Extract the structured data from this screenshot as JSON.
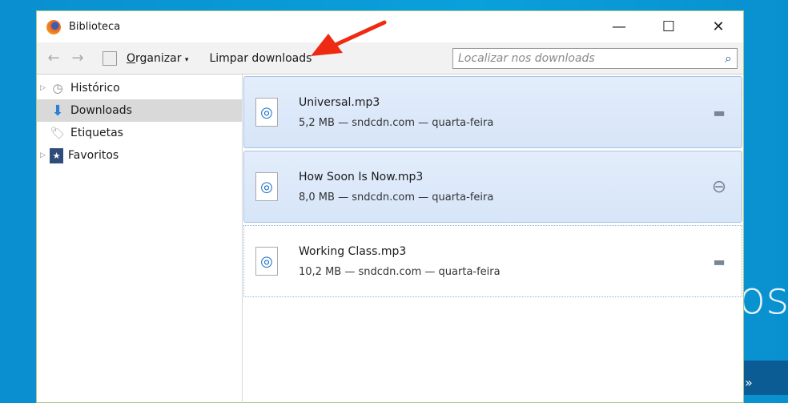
{
  "window": {
    "title": "Biblioteca",
    "minimize": "—",
    "maximize": "☐",
    "close": "✕"
  },
  "toolbar": {
    "back": "←",
    "forward": "→",
    "organize_key": "O",
    "organize_rest": "rganizar",
    "organize_caret": "▾",
    "clear": "Limpar downloads",
    "search_placeholder": "Localizar nos downloads"
  },
  "sidebar": {
    "items": [
      {
        "label": "Histórico",
        "icon": "clock-icon",
        "twisty": true
      },
      {
        "label": "Downloads",
        "icon": "download-arrow-icon",
        "selected": true
      },
      {
        "label": "Etiquetas",
        "icon": "tag-icon"
      },
      {
        "label": "Favoritos",
        "icon": "bookmarks-icon",
        "twisty": true
      }
    ]
  },
  "downloads": [
    {
      "name": "Universal.mp3",
      "meta": "5,2 MB — sndcdn.com — quarta-feira",
      "action": "folder-icon"
    },
    {
      "name": "How Soon Is Now.mp3",
      "meta": "8,0 MB — sndcdn.com — quarta-feira",
      "action": "open-folder-circle-icon"
    },
    {
      "name": "Working Class.mp3",
      "meta": "10,2 MB — sndcdn.com — quarta-feira",
      "action": "folder-icon"
    }
  ],
  "background": {
    "text": "os",
    "band": "»"
  },
  "colors": {
    "accent": "#1b6fc8",
    "annotation": "#ee2a12"
  }
}
